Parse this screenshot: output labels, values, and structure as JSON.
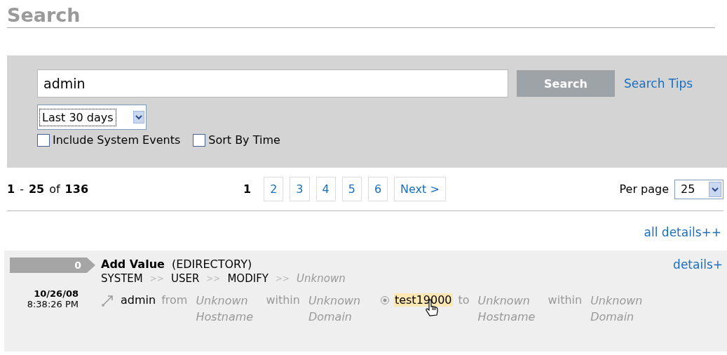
{
  "page_title": "Search",
  "search": {
    "query": "admin",
    "button": "Search",
    "tips_link": "Search Tips",
    "range": "Last 30 days",
    "options": [
      {
        "label": "Include System Events",
        "checked": false
      },
      {
        "label": "Sort By Time",
        "checked": false
      }
    ]
  },
  "results": {
    "from": "1",
    "to": "25",
    "of_label": "of",
    "total": "136",
    "separator": "-"
  },
  "pagination": {
    "pages": [
      {
        "label": "1",
        "selected": true
      },
      {
        "label": "2",
        "selected": false
      },
      {
        "label": "3",
        "selected": false
      },
      {
        "label": "4",
        "selected": false
      },
      {
        "label": "5",
        "selected": false
      },
      {
        "label": "6",
        "selected": false
      }
    ],
    "next": "Next >"
  },
  "per_page": {
    "label": "Per page",
    "value": "25"
  },
  "all_details_link": "all details++",
  "events": [
    {
      "severity": "0",
      "date": "10/26/08",
      "time": "8:38:26 PM",
      "name": "Add Value",
      "source": "(EDIRECTORY)",
      "path": [
        {
          "text": "SYSTEM",
          "known": true
        },
        {
          "text": "USER",
          "known": true
        },
        {
          "text": "MODIFY",
          "known": true
        },
        {
          "text": "Unknown",
          "known": false
        }
      ],
      "path_separator": ">>",
      "initiator": {
        "name": "admin",
        "from_label": "from",
        "host": "Unknown Hostname",
        "within_label": "within",
        "domain": "Unknown Domain"
      },
      "target": {
        "name": "test19000",
        "highlighted": true,
        "to_label": "to",
        "host": "Unknown Hostname",
        "within_label": "within",
        "domain": "Unknown Domain"
      },
      "details_link": "details+"
    }
  ]
}
